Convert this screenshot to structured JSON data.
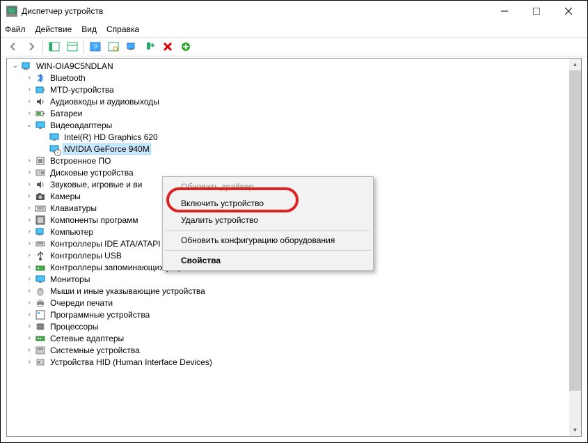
{
  "title": "Диспетчер устройств",
  "winbtns": {
    "min": "—",
    "max": "☐",
    "close": "✕"
  },
  "menu": {
    "file": "Файл",
    "action": "Действие",
    "view": "Вид",
    "help": "Справка"
  },
  "root": {
    "name": "WIN-OIA9C5NDLAN"
  },
  "tree": [
    {
      "label": "Bluetooth",
      "icon": "bluetooth",
      "expanded": false
    },
    {
      "label": "MTD-устройства",
      "icon": "mtd",
      "expanded": false
    },
    {
      "label": "Аудиовходы и аудиовыходы",
      "icon": "audio",
      "expanded": false
    },
    {
      "label": "Батареи",
      "icon": "battery",
      "expanded": false
    },
    {
      "label": "Видеоадаптеры",
      "icon": "display",
      "expanded": true,
      "children": [
        {
          "label": "Intel(R) HD Graphics 620",
          "icon": "display-card",
          "selected": false
        },
        {
          "label": "NVIDIA GeForce 940M",
          "icon": "display-card",
          "selected": true,
          "disabled": true
        }
      ]
    },
    {
      "label": "Встроенное ПО",
      "icon": "firmware",
      "expanded": false
    },
    {
      "label": "Дисковые устройства",
      "icon": "disk",
      "expanded": false
    },
    {
      "label": "Звуковые, игровые и ви",
      "icon": "sound",
      "expanded": false,
      "truncated": true
    },
    {
      "label": "Камеры",
      "icon": "camera",
      "expanded": false
    },
    {
      "label": "Клавиатуры",
      "icon": "keyboard",
      "expanded": false
    },
    {
      "label": "Компоненты программ",
      "icon": "software",
      "expanded": false,
      "truncated": true
    },
    {
      "label": "Компьютер",
      "icon": "computer",
      "expanded": false
    },
    {
      "label": "Контроллеры IDE ATA/ATAPI",
      "icon": "ide",
      "expanded": false
    },
    {
      "label": "Контроллеры USB",
      "icon": "usb",
      "expanded": false
    },
    {
      "label": "Контроллеры запоминающих устройств",
      "icon": "storage",
      "expanded": false
    },
    {
      "label": "Мониторы",
      "icon": "monitor",
      "expanded": false
    },
    {
      "label": "Мыши и иные указывающие устройства",
      "icon": "mouse",
      "expanded": false
    },
    {
      "label": "Очереди печати",
      "icon": "printer",
      "expanded": false
    },
    {
      "label": "Программные устройства",
      "icon": "software-dev",
      "expanded": false
    },
    {
      "label": "Процессоры",
      "icon": "cpu",
      "expanded": false
    },
    {
      "label": "Сетевые адаптеры",
      "icon": "network",
      "expanded": false
    },
    {
      "label": "Системные устройства",
      "icon": "system",
      "expanded": false
    },
    {
      "label": "Устройства HID (Human Interface Devices)",
      "icon": "hid",
      "expanded": false,
      "cutoff": true
    }
  ],
  "context": {
    "update_driver": "Обновить драйвер",
    "enable_device": "Включить устройство",
    "remove_device": "Удалить устройство",
    "scan_hardware": "Обновить конфигурацию оборудования",
    "properties": "Свойства"
  }
}
